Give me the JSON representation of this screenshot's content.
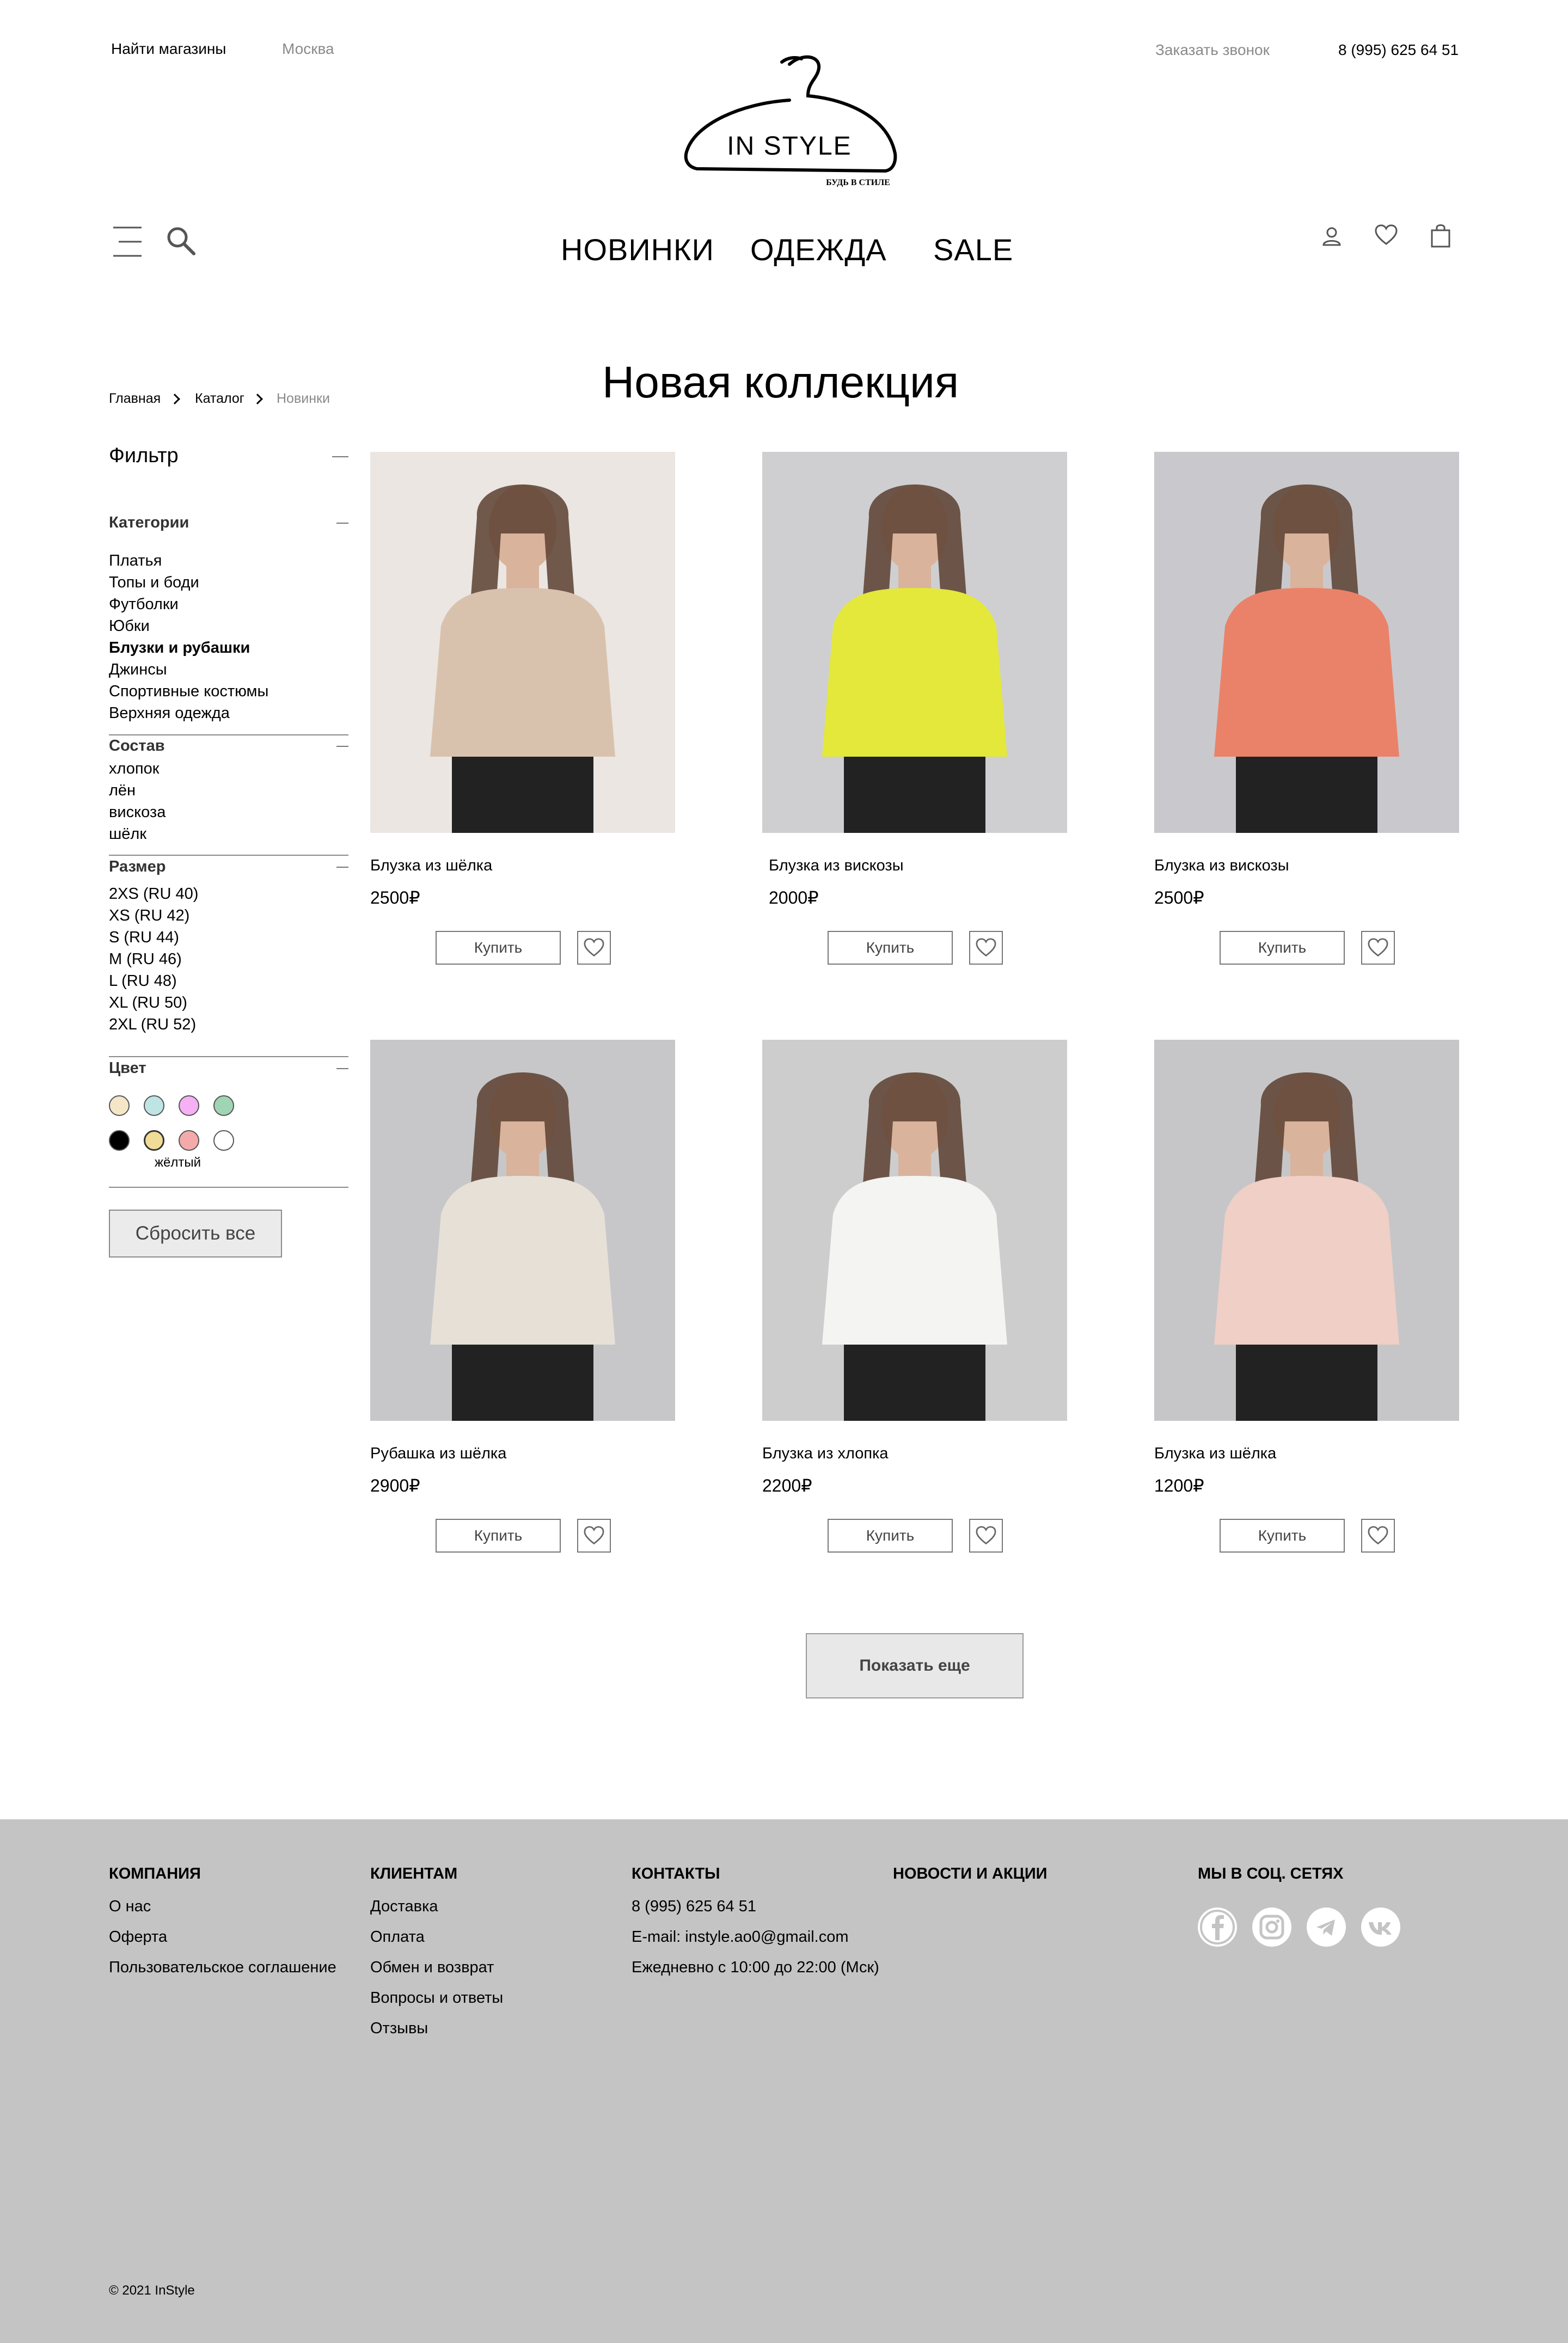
{
  "header": {
    "find_stores": "Найти магазины",
    "city": "Москва",
    "order_call": "Заказать звонок",
    "phone": "8 (995) 625 64 51"
  },
  "logo": {
    "name": "IN STYLE",
    "tagline": "БУДЬ В СТИЛЕ"
  },
  "nav": {
    "items": [
      "НОВИНКИ",
      "ОДЕЖДА",
      "SALE"
    ]
  },
  "breadcrumb": [
    "Главная",
    "Каталог",
    "Новинки"
  ],
  "page_title": "Новая коллекция",
  "filter": {
    "title": "Фильтр",
    "categories": {
      "title": "Категории",
      "items": [
        "Платья",
        "Топы и боди",
        "Футболки",
        "Юбки",
        "Блузки и рубашки",
        "Джинсы",
        "Спортивные костюмы",
        "Верхняя одежда"
      ],
      "active": "Блузки и рубашки"
    },
    "composition": {
      "title": "Состав",
      "items": [
        "хлопок",
        "лён",
        "вискоза",
        "шёлк"
      ]
    },
    "size": {
      "title": "Размер",
      "items": [
        "2XS (RU 40)",
        "XS (RU 42)",
        "S (RU 44)",
        "M (RU 46)",
        "L (RU 48)",
        "XL (RU 50)",
        "2XL (RU 52)"
      ]
    },
    "color": {
      "title": "Цвет",
      "swatches": [
        "#f5e6c8",
        "#bfe4e4",
        "#f6b0f4",
        "#9fd4b4",
        "#000000",
        "#f0dc96",
        "#f4aaaa",
        "#ffffff"
      ],
      "hover_caption": "жёлтый"
    },
    "reset_label": "Сбросить все"
  },
  "products": [
    {
      "name": "Блузка из шёлка",
      "price": "2500₽",
      "buy_label": "Купить",
      "garment_color": "#d9c2ad",
      "bg": "#ebe6e2"
    },
    {
      "name": "Блузка из вискозы",
      "price": "2000₽",
      "buy_label": "Купить",
      "garment_color": "#e3e83a",
      "bg": "#cfcfd1"
    },
    {
      "name": "Блузка из вискозы",
      "price": "2500₽",
      "buy_label": "Купить",
      "garment_color": "#ea8269",
      "bg": "#c9c9cd"
    },
    {
      "name": "Рубашка из шёлка",
      "price": "2900₽",
      "buy_label": "Купить",
      "garment_color": "#e6e0d6",
      "bg": "#c7c7c9"
    },
    {
      "name": "Блузка из хлопка",
      "price": "2200₽",
      "buy_label": "Купить",
      "garment_color": "#f4f4f2",
      "bg": "#cdcdcd"
    },
    {
      "name": "Блузка из шёлка",
      "price": "1200₽",
      "buy_label": "Купить",
      "garment_color": "#f0cfc6",
      "bg": "#c6c6c8"
    }
  ],
  "show_more_label": "Показать еще",
  "footer": {
    "columns": [
      {
        "title": "КОМПАНИЯ",
        "links": [
          "О нас",
          "Оферта",
          "Пользовательское соглашение"
        ]
      },
      {
        "title": "КЛИЕНТАМ",
        "links": [
          "Доставка",
          "Оплата",
          "Обмен и возврат",
          "Вопросы и  ответы",
          "Отзывы"
        ]
      },
      {
        "title": "КОНТАКТЫ",
        "links": [
          "8 (995) 625 64 51",
          "E-mail: instyle.ao0@gmail.com",
          "Ежедневно с 10:00 до 22:00 (Мск)"
        ]
      },
      {
        "title": "НОВОСТИ И АКЦИИ",
        "links": []
      }
    ],
    "social_title": "МЫ В СОЦ. СЕТЯХ",
    "social_icons": [
      "facebook-icon",
      "instagram-icon",
      "telegram-icon",
      "vk-icon"
    ],
    "copyright": "© 2021 InStyle"
  }
}
